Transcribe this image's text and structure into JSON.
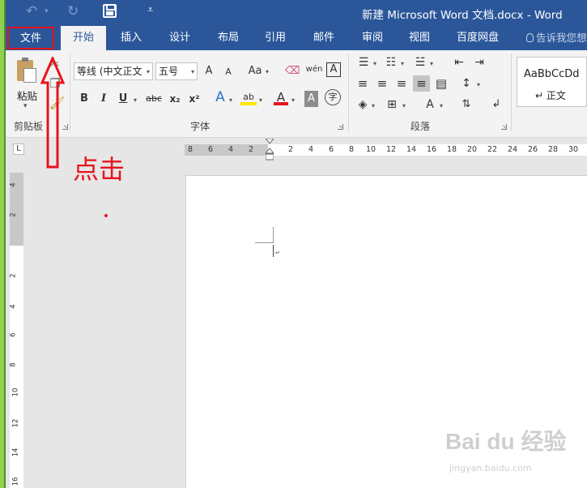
{
  "window": {
    "title": "新建 Microsoft Word 文档.docx - Word"
  },
  "quick_access": {
    "undo_icon": "↶",
    "redo_icon": "↻",
    "customize_icon": "₹",
    "customize_glyph": "⩡"
  },
  "tabs": [
    {
      "label": "文件"
    },
    {
      "label": "开始"
    },
    {
      "label": "插入"
    },
    {
      "label": "设计"
    },
    {
      "label": "布局"
    },
    {
      "label": "引用"
    },
    {
      "label": "邮件"
    },
    {
      "label": "审阅"
    },
    {
      "label": "视图"
    },
    {
      "label": "百度网盘"
    }
  ],
  "tell_me": "告诉我您想",
  "ribbon": {
    "clipboard": {
      "label": "剪贴板",
      "paste_label": "粘贴"
    },
    "font": {
      "label": "字体",
      "font_name": "等线 (中文正文",
      "font_size": "五号",
      "grow": "A",
      "shrink": "A",
      "change_case": "Aa",
      "phonetic": "wén",
      "bold": "B",
      "italic": "I",
      "underline": "U",
      "strike": "abc",
      "subscript": "x₂",
      "superscript": "x²",
      "effects": "A",
      "highlight": "ab",
      "font_color": "A",
      "char_shading": "A",
      "enclose": "字"
    },
    "paragraph": {
      "label": "段落"
    },
    "styles": {
      "sample": "AaBbCcDd",
      "normal": "正文"
    }
  },
  "ruler": {
    "tab_stop": "L",
    "horizontal_ticks": [
      "8",
      "6",
      "4",
      "2",
      "",
      "2",
      "4",
      "6",
      "8",
      "10",
      "12",
      "14",
      "16",
      "18",
      "20",
      "22",
      "24",
      "26",
      "28",
      "30"
    ],
    "vertical_ticks": [
      "4",
      "2",
      "",
      "2",
      "4",
      "6",
      "8",
      "10",
      "12",
      "14",
      "16"
    ]
  },
  "annotation": {
    "text": "点击",
    "color": "#e8141b"
  },
  "watermark": {
    "text": "Bai du 经验",
    "sub": "jingyan.baidu.com"
  }
}
